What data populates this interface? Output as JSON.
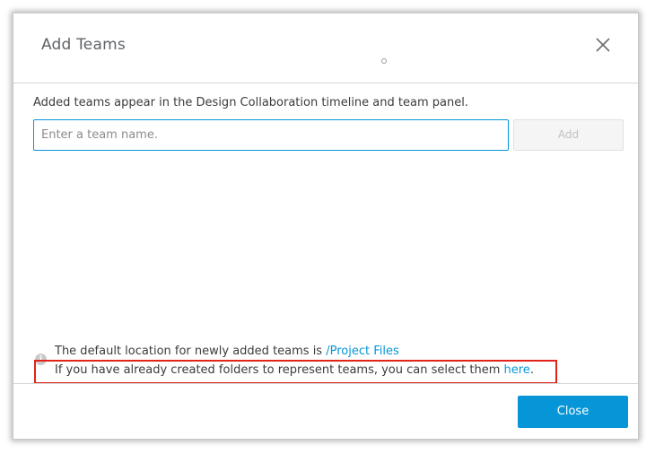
{
  "dialog": {
    "title": "Add Teams",
    "description": "Added teams appear in the Design Collaboration timeline and team panel.",
    "team_input": {
      "placeholder": "Enter a team name.",
      "value": ""
    },
    "add_label": "Add",
    "info": {
      "icon": "info-icon",
      "line1_text": "The default location for newly added teams is ",
      "line1_link": "/Project Files",
      "line2_text": "If you have already created folders to represent teams, you can select them ",
      "line2_link": "here",
      "line2_end": "."
    },
    "close_label": "Close"
  },
  "colors": {
    "accent": "#0696d7",
    "highlight_border": "#e2231a",
    "disabled_button_bg": "#f5f5f5"
  }
}
